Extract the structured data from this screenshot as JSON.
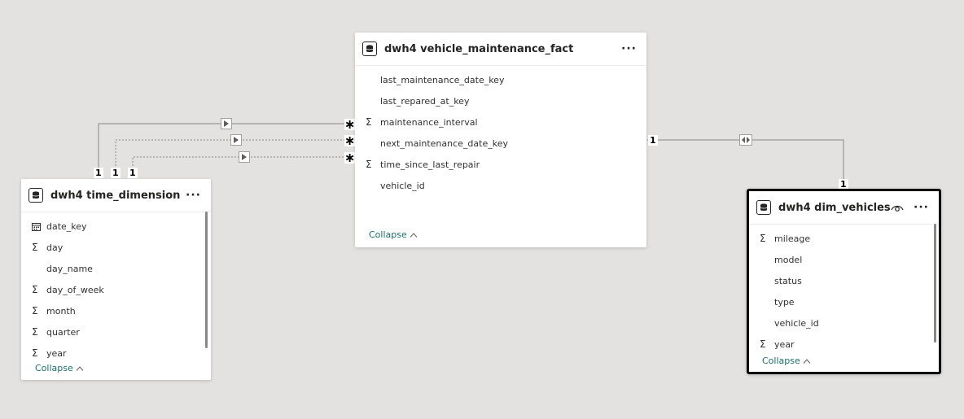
{
  "tables": {
    "fact": {
      "title": "dwh4 vehicle_maintenance_fact",
      "more": "···",
      "fields": [
        {
          "name": "last_maintenance_date_key",
          "icon": ""
        },
        {
          "name": "last_repared_at_key",
          "icon": ""
        },
        {
          "name": "maintenance_interval",
          "icon": "sigma"
        },
        {
          "name": "next_maintenance_date_key",
          "icon": ""
        },
        {
          "name": "time_since_last_repair",
          "icon": "sigma"
        },
        {
          "name": "vehicle_id",
          "icon": ""
        }
      ],
      "collapse": "Collapse"
    },
    "time": {
      "title": "dwh4 time_dimension",
      "more": "···",
      "fields": [
        {
          "name": "date_key",
          "icon": "calendar"
        },
        {
          "name": "day",
          "icon": "sigma"
        },
        {
          "name": "day_name",
          "icon": ""
        },
        {
          "name": "day_of_week",
          "icon": "sigma"
        },
        {
          "name": "month",
          "icon": "sigma"
        },
        {
          "name": "quarter",
          "icon": "sigma"
        },
        {
          "name": "year",
          "icon": "sigma"
        }
      ],
      "collapse": "Collapse"
    },
    "vehicles": {
      "title": "dwh4 dim_vehicles",
      "more": "···",
      "fields": [
        {
          "name": "mileage",
          "icon": "sigma"
        },
        {
          "name": "model",
          "icon": ""
        },
        {
          "name": "status",
          "icon": ""
        },
        {
          "name": "type",
          "icon": ""
        },
        {
          "name": "vehicle_id",
          "icon": ""
        },
        {
          "name": "year",
          "icon": "sigma"
        }
      ],
      "collapse": "Collapse"
    }
  },
  "relationships": {
    "one": "1",
    "many": "∗"
  }
}
